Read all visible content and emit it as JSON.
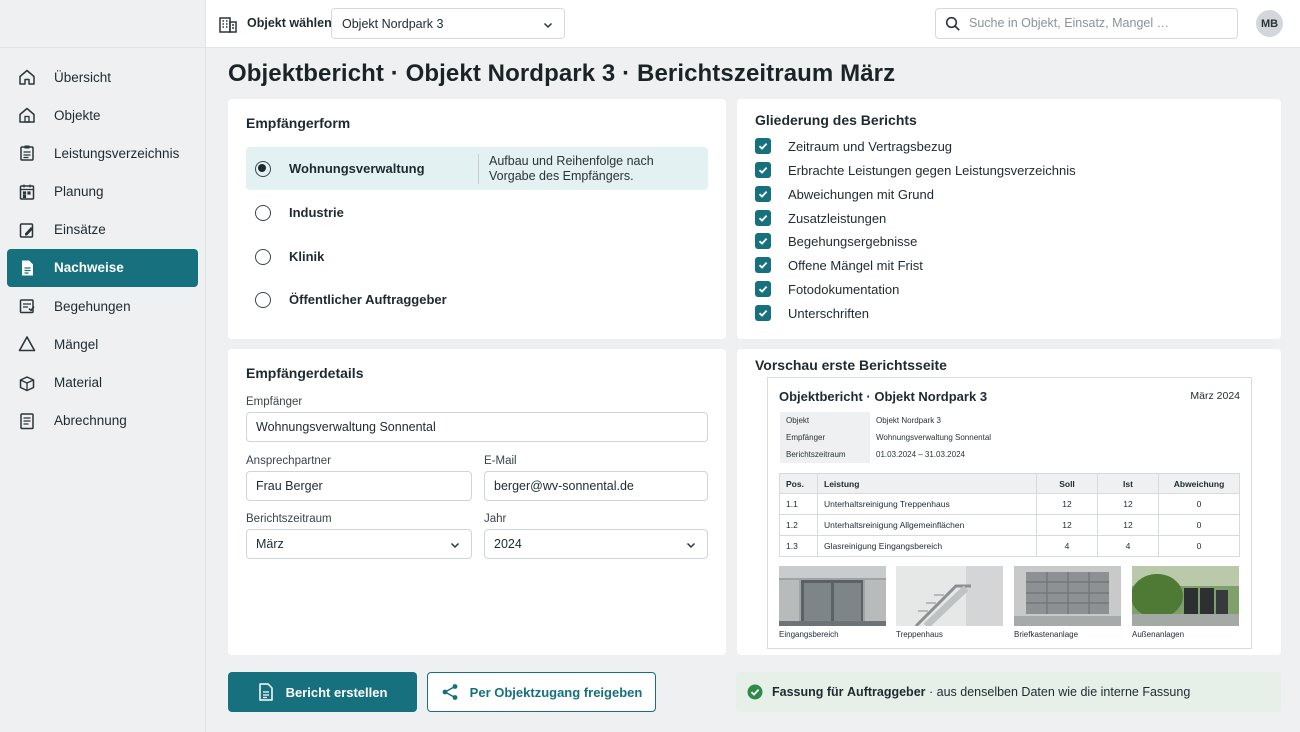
{
  "sidebar": {
    "items": [
      {
        "label": "Übersicht",
        "icon": "home-icon"
      },
      {
        "label": "Objekte",
        "icon": "building-icon"
      },
      {
        "label": "Leistungsverzeichnis",
        "icon": "clipboard-icon"
      },
      {
        "label": "Planung",
        "icon": "calendar-icon"
      },
      {
        "label": "Einsätze",
        "icon": "wrench-icon"
      },
      {
        "label": "Nachweise",
        "icon": "document-icon",
        "active": true
      },
      {
        "label": "Begehungen",
        "icon": "map-icon"
      },
      {
        "label": "Mängel",
        "icon": "warning-icon"
      },
      {
        "label": "Material",
        "icon": "box-icon"
      },
      {
        "label": "Abrechnung",
        "icon": "invoice-icon"
      }
    ]
  },
  "topbar": {
    "object_label": "Objekt wählen",
    "object_value": "Objekt Nordpark 3",
    "search_placeholder": "Suche in Objekt, Einsatz, Mangel …",
    "avatar_initials": "MB"
  },
  "page": {
    "title": "Objektbericht · Objekt Nordpark 3 · Berichtszeitraum März"
  },
  "recipient_form": {
    "title": "Empfängerform",
    "options": [
      {
        "label": "Wohnungsverwaltung",
        "description": "Aufbau und Reihenfolge nach Vorgabe des Empfängers.",
        "selected": true
      },
      {
        "label": "Industrie",
        "selected": false
      },
      {
        "label": "Klinik",
        "selected": false
      },
      {
        "label": "Öffentlicher Auftraggeber",
        "selected": false
      }
    ]
  },
  "outline": {
    "title": "Gliederung des Berichts",
    "items": [
      {
        "label": "Zeitraum und Vertragsbezug",
        "checked": true
      },
      {
        "label": "Erbrachte Leistungen gegen Leistungsverzeichnis",
        "checked": true
      },
      {
        "label": "Abweichungen mit Grund",
        "checked": true
      },
      {
        "label": "Zusatzleistungen",
        "checked": true
      },
      {
        "label": "Begehungsergebnisse",
        "checked": true
      },
      {
        "label": "Offene Mängel mit Frist",
        "checked": true
      },
      {
        "label": "Fotodokumentation",
        "checked": true
      },
      {
        "label": "Unterschriften",
        "checked": true
      }
    ]
  },
  "recipient_details": {
    "title": "Empfängerdetails",
    "recipient_label": "Empfänger",
    "recipient_value": "Wohnungsverwaltung Sonnental",
    "contact_label": "Ansprechpartner",
    "contact_value": "Frau Berger",
    "email_label": "E-Mail",
    "email_value": "berger@wv-sonnental.de",
    "period_label": "Berichtszeitraum",
    "period_value": "März",
    "year_label": "Jahr",
    "year_value": "2024"
  },
  "preview": {
    "title": "Vorschau erste Berichtsseite",
    "doc_title": "Objektbericht · Objekt Nordpark 3",
    "doc_date": "März 2024",
    "meta": [
      {
        "key": "Objekt",
        "value": "Objekt Nordpark 3"
      },
      {
        "key": "Empfänger",
        "value": "Wohnungsverwaltung Sonnental"
      },
      {
        "key": "Berichtszeitraum",
        "value": "01.03.2024 – 31.03.2024"
      }
    ],
    "table": {
      "headers": [
        "Pos.",
        "Leistung",
        "Soll",
        "Ist",
        "Abweichung"
      ],
      "rows": [
        [
          "1.1",
          "Unterhaltsreinigung Treppenhaus",
          "12",
          "12",
          "0"
        ],
        [
          "1.2",
          "Unterhaltsreinigung Allgemeinflächen",
          "12",
          "12",
          "0"
        ],
        [
          "1.3",
          "Glasreinigung Eingangsbereich",
          "4",
          "4",
          "0"
        ]
      ]
    },
    "photos": [
      {
        "caption": "Eingangsbereich"
      },
      {
        "caption": "Treppenhaus"
      },
      {
        "caption": "Briefkastenanlage"
      },
      {
        "caption": "Außenanlagen"
      }
    ]
  },
  "actions": {
    "create_label": "Bericht erstellen",
    "share_label": "Per Objektzugang freigeben",
    "status_prefix": "Fassung für",
    "status_bold": "Auftraggeber",
    "status_suffix": "· aus denselben Daten wie die interne Fassung"
  },
  "colors": {
    "accent": "#16707d",
    "selected_bg": "#e4f1f3",
    "success_bg": "#e6f0e9",
    "success_icon": "#2e8b4a"
  }
}
